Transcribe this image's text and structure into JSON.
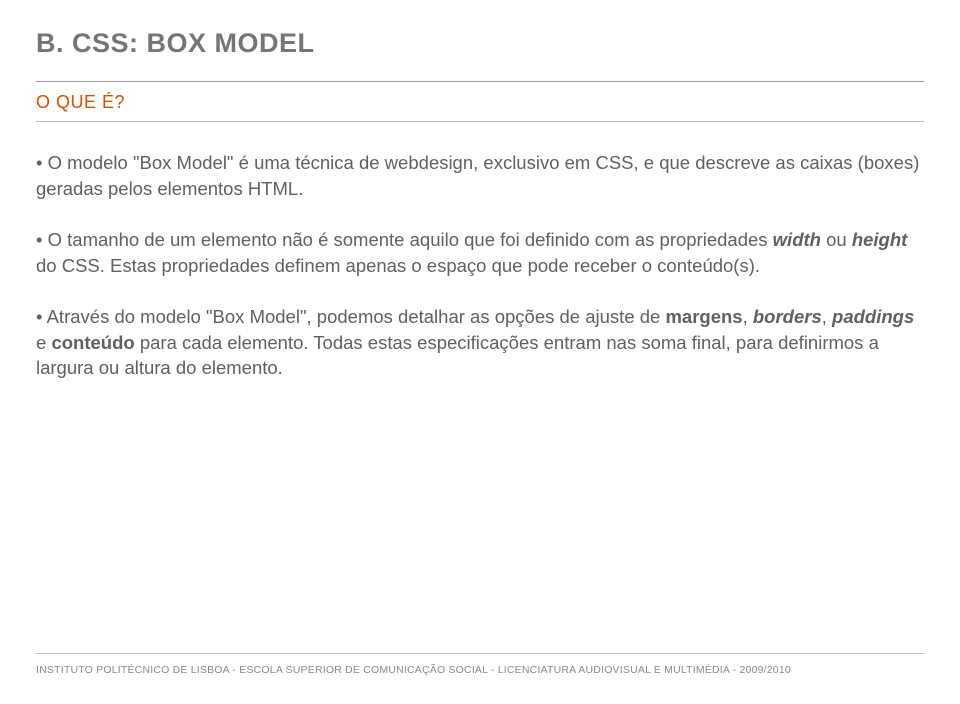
{
  "title": "B. CSS: BOX MODEL",
  "subtitle": "O QUE É?",
  "p1": {
    "prefix": "• O modelo \"Box Model\" é uma técnica de webdesign, exclusivo em CSS, e que descreve as caixas (boxes) geradas pelos elementos HTML."
  },
  "p2": {
    "a": "• O tamanho de um elemento não é somente aquilo que foi definido com as propriedades ",
    "width": "width",
    "b": " ou ",
    "height": "height",
    "c": " do CSS. Estas propriedades definem apenas o espaço que pode receber o conteúdo(s)."
  },
  "p3": {
    "a": "• Através do modelo \"Box Model\", podemos detalhar as opções de ajuste de ",
    "margens": "margens",
    "sep1": ", ",
    "borders": "borders",
    "sep2": ", ",
    "paddings": "paddings",
    "sep3": " e ",
    "conteudo": "conteúdo",
    "b": " para cada elemento. Todas estas especificações entram nas soma final, para definirmos a largura ou altura do elemento."
  },
  "footer": "INSTITUTO POLITÉCNICO DE LISBOA - ESCOLA SUPERIOR DE COMUNICAÇÃO SOCIAL - LICENCIATURA AUDIOVISUAL E MULTIMÉDIA - 2009/2010"
}
